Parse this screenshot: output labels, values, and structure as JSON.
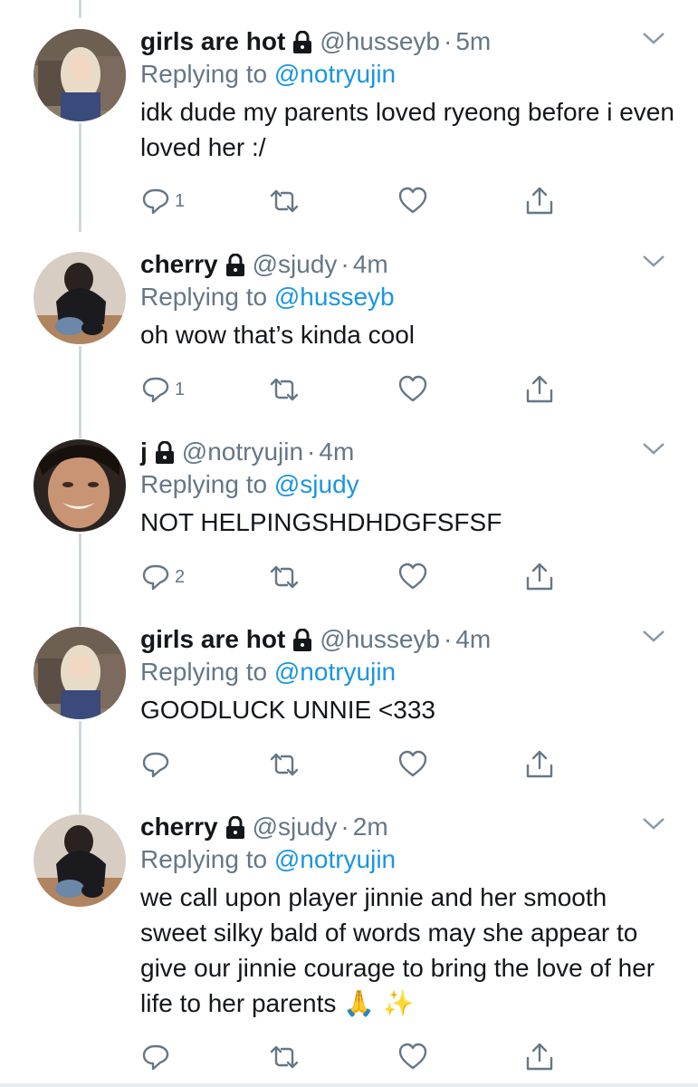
{
  "tweets": [
    {
      "name": "girls are hot",
      "handle": "@husseyb",
      "dot": "·",
      "time": "5m",
      "replying_prefix": "Replying to",
      "replying_to": "@notryujin",
      "text": "idk dude my parents loved ryeong before i even loved her :/",
      "reply_count": "1",
      "avatar": "blonde-girl-avatar"
    },
    {
      "name": "cherry",
      "handle": "@sjudy",
      "dot": "·",
      "time": "4m",
      "replying_prefix": "Replying to",
      "replying_to": "@husseyb",
      "text": "oh wow that’s kinda cool",
      "reply_count": "1",
      "avatar": "crouching-person-avatar"
    },
    {
      "name": "j",
      "handle": "@notryujin",
      "dot": "·",
      "time": "4m",
      "replying_prefix": "Replying to",
      "replying_to": "@sjudy",
      "text": "NOT HELPINGSHDHDGFSFSF",
      "reply_count": "2",
      "avatar": "smiling-face-avatar"
    },
    {
      "name": "girls are hot",
      "handle": "@husseyb",
      "dot": "·",
      "time": "4m",
      "replying_prefix": "Replying to",
      "replying_to": "@notryujin",
      "text": "GOODLUCK UNNIE <333",
      "reply_count": "",
      "avatar": "blonde-girl-avatar"
    },
    {
      "name": "cherry",
      "handle": "@sjudy",
      "dot": "·",
      "time": "2m",
      "replying_prefix": "Replying to",
      "replying_to": "@notryujin",
      "text": "we call upon player jinnie and her smooth sweet silky bald of words may she appear to give our jinnie courage to bring the love of her life to her parents",
      "text_emoji": "🙏 ✨",
      "reply_count": "",
      "avatar": "crouching-person-avatar"
    }
  ],
  "colors": {
    "text": "#14171a",
    "secondary": "#657786",
    "mention": "#1b95e0",
    "thread_line": "#cfd9de"
  },
  "icons": [
    "lock-icon",
    "chevron-down-icon",
    "reply-icon",
    "retweet-icon",
    "like-icon",
    "share-icon"
  ]
}
